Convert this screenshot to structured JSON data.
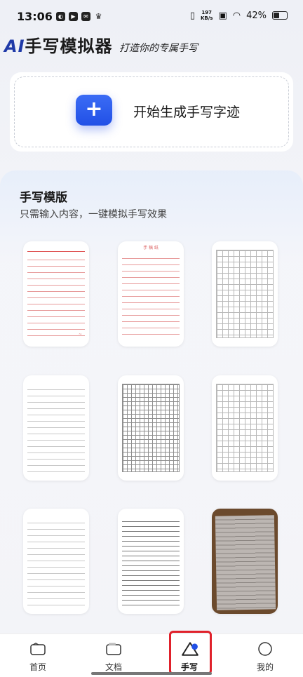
{
  "status_bar": {
    "time": "13:06",
    "net_speed_top": "197",
    "net_speed_unit": "KB/s",
    "battery": "42%",
    "icons": [
      "vibrate-icon",
      "wifi-icon",
      "battery-icon"
    ]
  },
  "header": {
    "title_prefix": "AI",
    "title_rest": "手写模拟器",
    "subtitle": "打造你的专属手写"
  },
  "generate": {
    "button_glyph": "+",
    "label": "开始生成手写字迹"
  },
  "templates": {
    "title": "手写模版",
    "description": "只需输入内容，一键模拟手写效果",
    "items": [
      {
        "style": "red-lined"
      },
      {
        "style": "red-lined-titled",
        "header_text": "手 稿 纸"
      },
      {
        "style": "grid"
      },
      {
        "style": "gray-lined"
      },
      {
        "style": "dark-grid"
      },
      {
        "style": "grid"
      },
      {
        "style": "gray-lined"
      },
      {
        "style": "dark-lined"
      },
      {
        "style": "photo-paper"
      }
    ]
  },
  "nav": {
    "items": [
      {
        "label": "首页",
        "icon": "home-icon"
      },
      {
        "label": "文档",
        "icon": "document-icon"
      },
      {
        "label": "手写",
        "icon": "handwriting-icon",
        "active": true
      },
      {
        "label": "我的",
        "icon": "profile-icon"
      }
    ]
  },
  "colors": {
    "accent": "#2150e6",
    "highlight": "#e0212b",
    "title_blue": "#1f3aa8"
  }
}
